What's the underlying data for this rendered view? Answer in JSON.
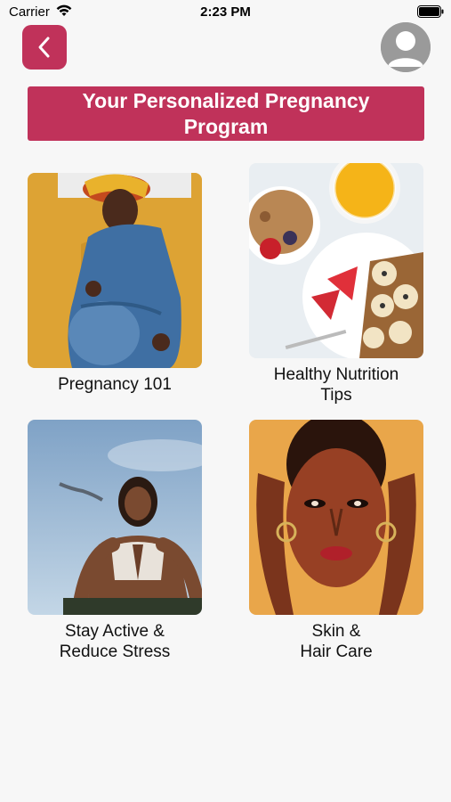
{
  "status_bar": {
    "carrier": "Carrier",
    "time": "2:23 PM"
  },
  "header": {
    "back_icon": "chevron-left-icon",
    "avatar_icon": "user-avatar-icon"
  },
  "banner": {
    "title": "Your Personalized Pregnancy Program"
  },
  "cards": [
    {
      "caption": "Pregnancy 101"
    },
    {
      "caption": "Healthy Nutrition\nTips"
    },
    {
      "caption": "Stay Active &\nReduce Stress"
    },
    {
      "caption": "Skin &\nHair Care"
    }
  ],
  "colors": {
    "accent": "#c0325a",
    "background": "#f7f7f7"
  }
}
